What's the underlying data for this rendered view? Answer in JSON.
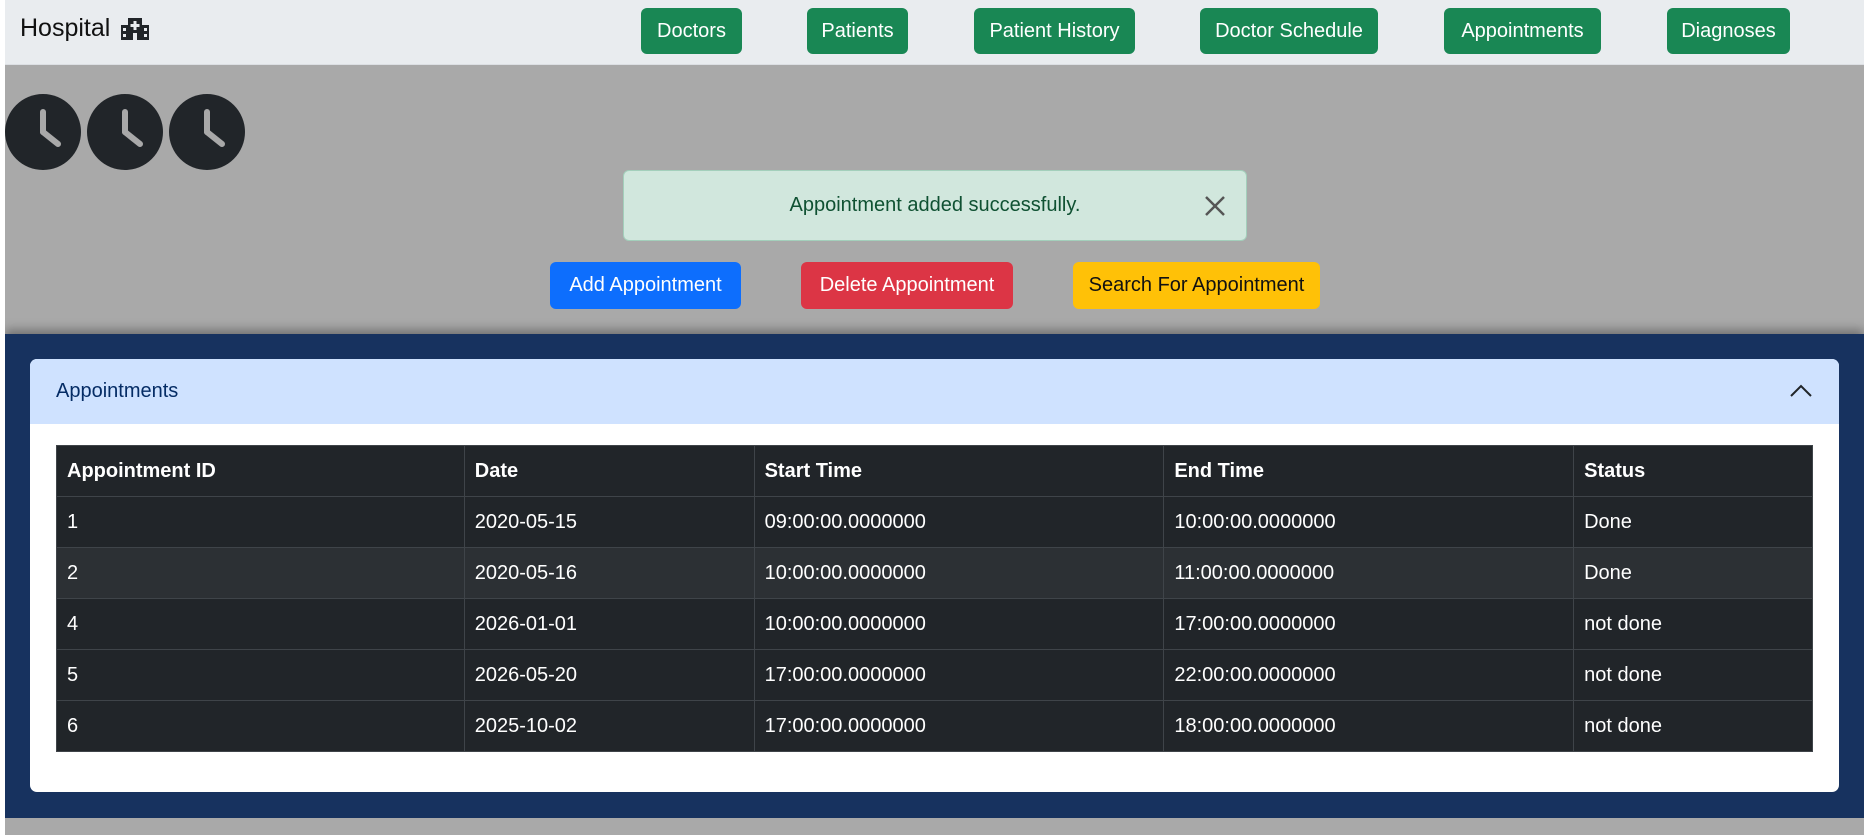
{
  "brand": {
    "title": "Hospital",
    "icon": "hospital-icon"
  },
  "nav": {
    "items": [
      {
        "label": "Doctors"
      },
      {
        "label": "Patients"
      },
      {
        "label": "Patient History"
      },
      {
        "label": "Doctor Schedule"
      },
      {
        "label": "Appointments"
      },
      {
        "label": "Diagnoses"
      }
    ],
    "color": "#198754"
  },
  "clocks": {
    "count": 3,
    "icon": "clock-icon"
  },
  "alert": {
    "message": "Appointment added successfully.",
    "close_icon": "close-icon"
  },
  "actions": {
    "add": {
      "label": "Add Appointment",
      "color": "#0d6efd"
    },
    "delete": {
      "label": "Delete Appointment",
      "color": "#dc3545"
    },
    "search": {
      "label": "Search For Appointment",
      "color": "#ffc107"
    }
  },
  "card": {
    "title": "Appointments",
    "toggle_icon": "chevron-up-icon",
    "columns": [
      "Appointment ID",
      "Date",
      "Start Time",
      "End Time",
      "Status"
    ],
    "rows": [
      {
        "id": "1",
        "date": "2020-05-15",
        "start": "09:00:00.0000000",
        "end": "10:00:00.0000000",
        "status": "Done"
      },
      {
        "id": "2",
        "date": "2020-05-16",
        "start": "10:00:00.0000000",
        "end": "11:00:00.0000000",
        "status": "Done"
      },
      {
        "id": "4",
        "date": "2026-01-01",
        "start": "10:00:00.0000000",
        "end": "17:00:00.0000000",
        "status": "not done"
      },
      {
        "id": "5",
        "date": "2026-05-20",
        "start": "17:00:00.0000000",
        "end": "22:00:00.0000000",
        "status": "not done"
      },
      {
        "id": "6",
        "date": "2025-10-02",
        "start": "17:00:00.0000000",
        "end": "18:00:00.0000000",
        "status": "not done"
      }
    ]
  }
}
